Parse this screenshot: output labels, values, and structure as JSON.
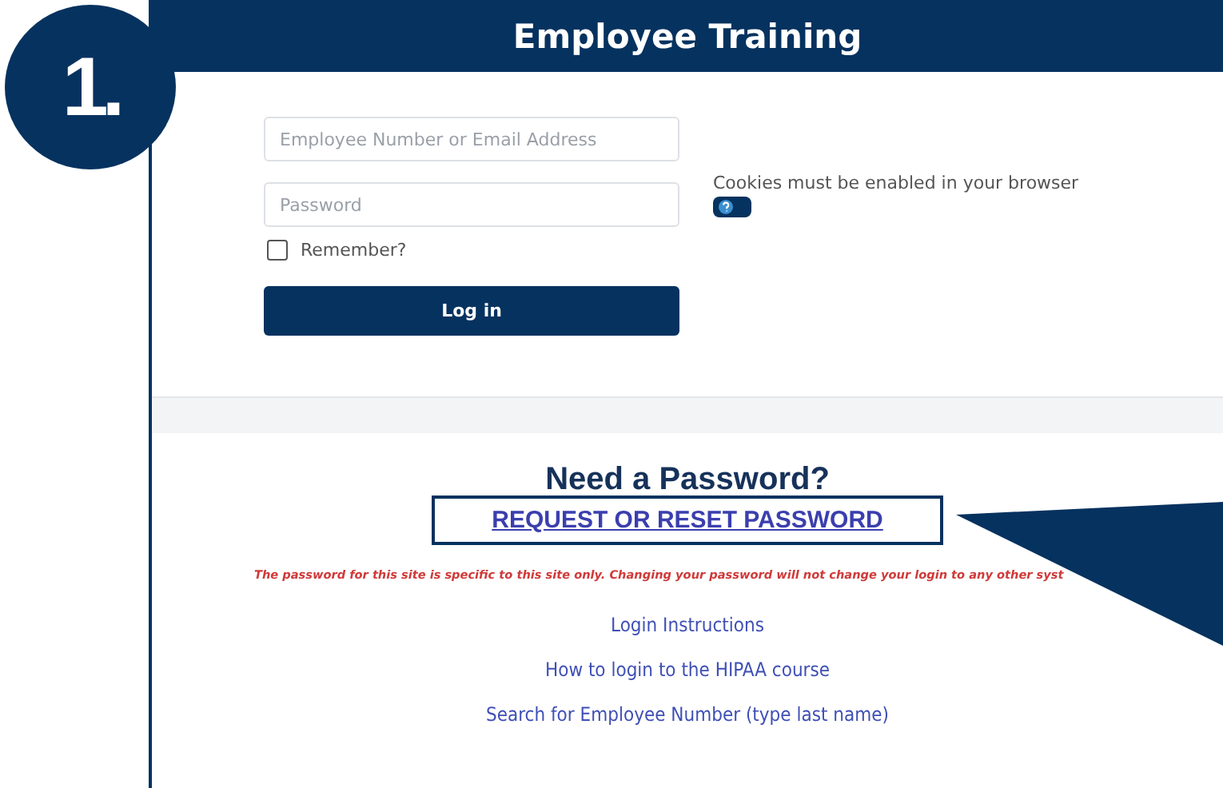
{
  "annotation": {
    "step": "1."
  },
  "header": {
    "title": "Employee Training"
  },
  "login": {
    "username": {
      "placeholder": "Employee Number or Email Address"
    },
    "password": {
      "placeholder": "Password"
    },
    "remember": {
      "label": "Remember?",
      "checked": false
    },
    "button": "Log in",
    "cookie_note": "Cookies must be enabled in your browser"
  },
  "password_help": {
    "heading": "Need a Password?",
    "reset_link": {
      "label": "REQUEST OR RESET PASSWORD",
      "highlighted": true
    },
    "warning": "The password for this site is specific to this site only. Changing your password will not change your login to any other syst",
    "links": [
      "Login Instructions",
      "How to login to the HIPAA course",
      "Search for Employee Number (type last name)"
    ]
  }
}
